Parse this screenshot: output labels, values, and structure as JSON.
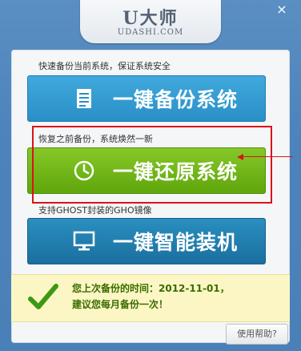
{
  "header": {
    "logo_main": "U大师",
    "logo_sub": "UDASHI.COM",
    "close_label": "×"
  },
  "captions": {
    "backup": "快速备份当前系统，保证系统安全",
    "restore": "恢复之前备份，系统焕然一新",
    "install": "支持GHOST封装的GHO镜像"
  },
  "buttons": {
    "backup": "一键备份系统",
    "restore": "一键还原系统",
    "install": "一键智能装机"
  },
  "notice": {
    "line1": "您上次备份的时间：2012-11-01，",
    "line2": "建议您每月备份一次！"
  },
  "footer": {
    "help_label": "使用帮助?"
  },
  "colors": {
    "backup": "#2a8fc7",
    "restore": "#6aae12",
    "install": "#1e78a8",
    "highlight": "#d8141a",
    "notice_bg": "#fbf6c4"
  },
  "icons": {
    "backup": "document-icon",
    "restore": "clock-icon",
    "install": "monitor-icon",
    "notice": "checkmark-icon"
  }
}
